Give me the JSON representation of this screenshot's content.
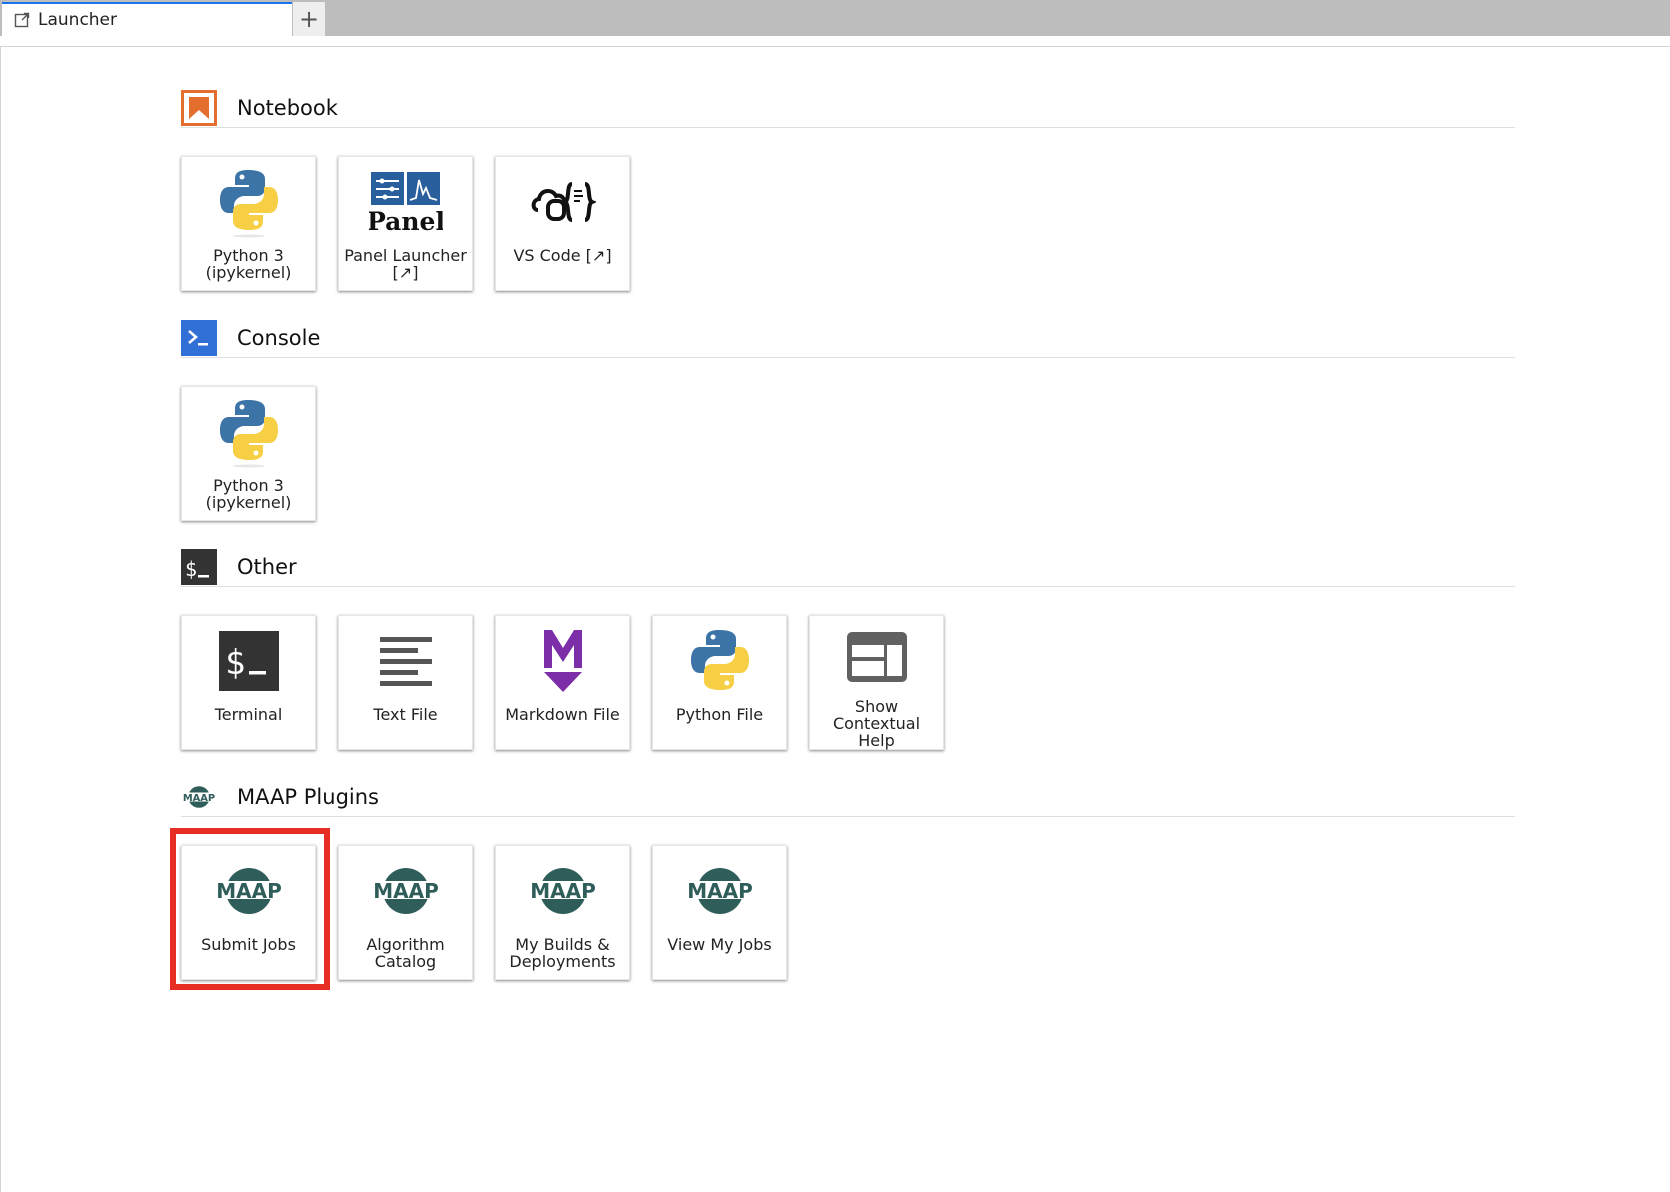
{
  "tab": {
    "label": "Launcher",
    "new_tab_symbol": "+"
  },
  "sections": {
    "notebook": {
      "title": "Notebook",
      "icon": "notebook-icon",
      "cards": [
        {
          "label": "Python 3 (ipykernel)",
          "icon": "python-icon"
        },
        {
          "label": "Panel Launcher [↗]",
          "icon": "panel-icon",
          "logo_text": "Panel"
        },
        {
          "label": "VS Code [↗]",
          "icon": "vscode-icon"
        }
      ]
    },
    "console": {
      "title": "Console",
      "icon": "console-icon",
      "cards": [
        {
          "label": "Python 3 (ipykernel)",
          "icon": "python-icon"
        }
      ]
    },
    "other": {
      "title": "Other",
      "icon": "terminal-icon",
      "cards": [
        {
          "label": "Terminal",
          "icon": "terminal-icon"
        },
        {
          "label": "Text File",
          "icon": "text-file-icon"
        },
        {
          "label": "Markdown File",
          "icon": "markdown-icon"
        },
        {
          "label": "Python File",
          "icon": "python-icon"
        },
        {
          "label": "Show Contextual Help",
          "icon": "contextual-help-icon"
        }
      ]
    },
    "maap": {
      "title": "MAAP Plugins",
      "icon": "maap-icon",
      "logo_text": "MAAP",
      "cards": [
        {
          "label": "Submit Jobs",
          "icon": "maap-icon"
        },
        {
          "label": "Algorithm Catalog",
          "icon": "maap-icon"
        },
        {
          "label": "My Builds & Deployments",
          "icon": "maap-icon"
        },
        {
          "label": "View My Jobs",
          "icon": "maap-icon"
        }
      ]
    }
  },
  "colors": {
    "notebook_orange": "#e46e2e",
    "console_blue": "#2f6fd6",
    "terminal_dark": "#333333",
    "markdown_purple": "#7b2ea8",
    "python_blue": "#3d74a8",
    "python_yellow": "#f7cf45",
    "maap_green": "#2f5d5a",
    "highlight_red": "#e62e25",
    "tab_accent": "#1a73e8"
  }
}
